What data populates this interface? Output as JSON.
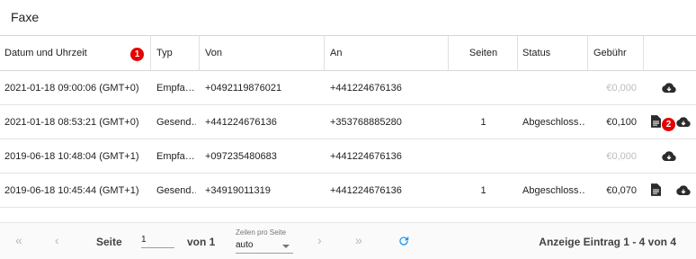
{
  "page": {
    "title": "Faxe"
  },
  "columns": {
    "datetime": "Datum und Uhrzeit",
    "type": "Typ",
    "from": "Von",
    "to": "An",
    "pages": "Seiten",
    "status": "Status",
    "fee": "Gebühr"
  },
  "badges": {
    "b1": "1",
    "b2": "2"
  },
  "rows": [
    {
      "datetime": "2021-01-18 09:00:06 (GMT+0)",
      "type": "Empfa…",
      "from": "+0492119876021",
      "to": "+441224676136",
      "pages": "",
      "status": "",
      "fee": "€0,000",
      "fee_muted": true,
      "has_doc": false
    },
    {
      "datetime": "2021-01-18 08:53:21 (GMT+0)",
      "type": "Gesend…",
      "from": "+441224676136",
      "to": "+353768885280",
      "pages": "1",
      "status": "Abgeschloss…",
      "fee": "€0,100",
      "fee_muted": false,
      "has_doc": true
    },
    {
      "datetime": "2019-06-18 10:48:04 (GMT+1)",
      "type": "Empfa…",
      "from": "+097235480683",
      "to": "+441224676136",
      "pages": "",
      "status": "",
      "fee": "€0,000",
      "fee_muted": true,
      "has_doc": false
    },
    {
      "datetime": "2019-06-18 10:45:44 (GMT+1)",
      "type": "Gesend…",
      "from": "+34919011319",
      "to": "+441224676136",
      "pages": "1",
      "status": "Abgeschloss…",
      "fee": "€0,070",
      "fee_muted": false,
      "has_doc": true
    }
  ],
  "icons": {
    "first_page": "«",
    "prev_page": "‹",
    "next_page": "›",
    "last_page": "»",
    "refresh": "refresh-icon",
    "download": "cloud-download-icon",
    "document": "document-icon"
  },
  "pagination": {
    "page_label": "Seite",
    "page_value": "1",
    "of_label": "von 1",
    "rows_per_page_label": "Zeilen pro Seite",
    "rows_per_page_value": "auto",
    "summary": "Anzeige Eintrag 1 - 4 von 4"
  },
  "colors": {
    "accent": "#2196f3",
    "badge": "#e60000",
    "muted": "#bdbdbd"
  }
}
